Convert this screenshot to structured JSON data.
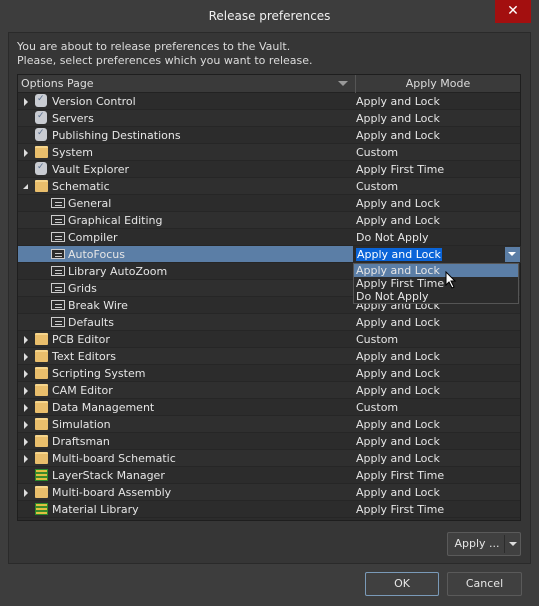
{
  "window": {
    "title": "Release preferences",
    "close_icon": "close-icon"
  },
  "intro": {
    "line1": "You are about to release preferences to the Vault.",
    "line2": "Please, select preferences which you want to release."
  },
  "table": {
    "columns": [
      "Options Page",
      "Apply Mode"
    ],
    "rows": [
      {
        "name": "Version Control",
        "mode": "Apply and Lock",
        "icon": "database-check",
        "level": 0,
        "expander": "closed"
      },
      {
        "name": "Servers",
        "mode": "Apply and Lock",
        "icon": "database-check",
        "level": 0,
        "expander": "none"
      },
      {
        "name": "Publishing Destinations",
        "mode": "Apply and Lock",
        "icon": "database-check",
        "level": 0,
        "expander": "none"
      },
      {
        "name": "System",
        "mode": "Custom",
        "icon": "folder",
        "level": 0,
        "expander": "closed"
      },
      {
        "name": "Vault Explorer",
        "mode": "Apply First Time",
        "icon": "database-check",
        "level": 0,
        "expander": "none"
      },
      {
        "name": "Schematic",
        "mode": "Custom",
        "icon": "folder-open",
        "level": 0,
        "expander": "open"
      },
      {
        "name": "General",
        "mode": "Apply and Lock",
        "icon": "page",
        "level": 1,
        "expander": "none"
      },
      {
        "name": "Graphical Editing",
        "mode": "Apply and Lock",
        "icon": "page",
        "level": 1,
        "expander": "none"
      },
      {
        "name": "Compiler",
        "mode": "Do Not Apply",
        "icon": "page",
        "level": 1,
        "expander": "none"
      },
      {
        "name": "AutoFocus",
        "mode": "Apply and Lock",
        "icon": "page",
        "level": 1,
        "expander": "none",
        "selected": true
      },
      {
        "name": "Library AutoZoom",
        "mode": "",
        "icon": "page",
        "level": 1,
        "expander": "none"
      },
      {
        "name": "Grids",
        "mode": "",
        "icon": "page",
        "level": 1,
        "expander": "none"
      },
      {
        "name": "Break Wire",
        "mode": "Apply and Lock",
        "icon": "page",
        "level": 1,
        "expander": "none"
      },
      {
        "name": "Defaults",
        "mode": "Apply and Lock",
        "icon": "page",
        "level": 1,
        "expander": "none"
      },
      {
        "name": "PCB Editor",
        "mode": "Custom",
        "icon": "folder",
        "level": 0,
        "expander": "closed"
      },
      {
        "name": "Text Editors",
        "mode": "Apply and Lock",
        "icon": "folder",
        "level": 0,
        "expander": "closed"
      },
      {
        "name": "Scripting System",
        "mode": "Apply and Lock",
        "icon": "folder",
        "level": 0,
        "expander": "closed"
      },
      {
        "name": "CAM Editor",
        "mode": "Apply and Lock",
        "icon": "folder",
        "level": 0,
        "expander": "closed"
      },
      {
        "name": "Data Management",
        "mode": "Custom",
        "icon": "folder",
        "level": 0,
        "expander": "closed"
      },
      {
        "name": "Simulation",
        "mode": "Apply and Lock",
        "icon": "folder",
        "level": 0,
        "expander": "closed"
      },
      {
        "name": "Draftsman",
        "mode": "Apply and Lock",
        "icon": "folder",
        "level": 0,
        "expander": "closed"
      },
      {
        "name": "Multi-board Schematic",
        "mode": "Apply and Lock",
        "icon": "folder",
        "level": 0,
        "expander": "closed"
      },
      {
        "name": "LayerStack Manager",
        "mode": "Apply First Time",
        "icon": "layer-stack",
        "level": 0,
        "expander": "none"
      },
      {
        "name": "Multi-board Assembly",
        "mode": "Apply and Lock",
        "icon": "folder",
        "level": 0,
        "expander": "closed"
      },
      {
        "name": "Material Library",
        "mode": "Apply First Time",
        "icon": "layer-stack",
        "level": 0,
        "expander": "none"
      }
    ]
  },
  "dropdown": {
    "options": [
      "Apply and Lock",
      "Apply First Time",
      "Do Not Apply"
    ],
    "highlighted": "Apply and Lock"
  },
  "buttons": {
    "apply": "Apply ...",
    "ok": "OK",
    "cancel": "Cancel"
  },
  "colors": {
    "selection": "#5b7ea6",
    "text_highlight": "#0a64d8",
    "close": "#a30f0f"
  }
}
